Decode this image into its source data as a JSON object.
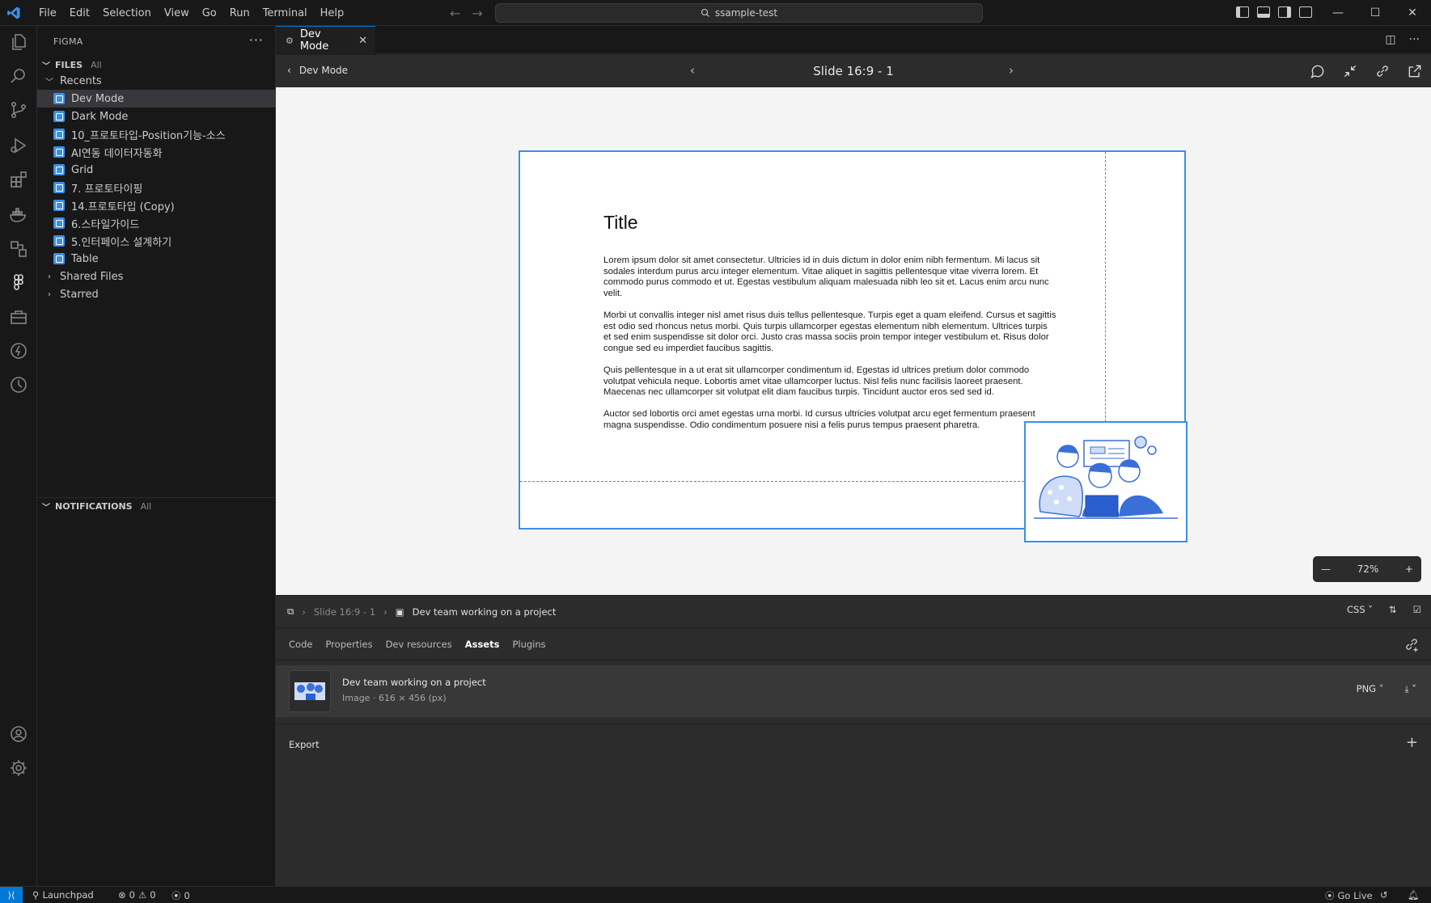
{
  "window": {
    "menu": [
      "File",
      "Edit",
      "Selection",
      "View",
      "Go",
      "Run",
      "Terminal",
      "Help"
    ],
    "search": "ssample-test"
  },
  "sidebar": {
    "title": "FIGMA",
    "files_section": {
      "label": "FILES",
      "filter": "All"
    },
    "recents_label": "Recents",
    "recents": [
      "Dev Mode",
      "Dark Mode",
      "10_프로토타입-Position기능-소스",
      "AI연동 데이터자동화",
      "Grid",
      "7. 프로토타이핑",
      "14.프로토타입 (Copy)",
      "6.스타일가이드",
      "5.인터페이스 설계하기",
      "Table"
    ],
    "shared_label": "Shared Files",
    "starred_label": "Starred",
    "notifications_section": {
      "label": "NOTIFICATIONS",
      "filter": "All"
    }
  },
  "editor": {
    "tab_label": "Dev Mode",
    "devbar": {
      "back_label": "Dev Mode",
      "slide_title": "Slide 16:9 - 1",
      "zoom": "72%"
    },
    "slide": {
      "title": "Title",
      "paragraphs": [
        "Lorem ipsum dolor sit amet consectetur. Ultricies id in duis dictum in dolor enim nibh fermentum. Mi lacus sit sodales interdum purus arcu integer elementum. Vitae aliquet in sagittis pellentesque vitae viverra lorem. Et commodo purus commodo et ut. Egestas vestibulum aliquam malesuada nibh leo sit et. Lacus enim arcu nunc velit.",
        "Morbi ut convallis integer nisl amet risus duis tellus pellentesque. Turpis eget a quam eleifend. Cursus et sagittis est odio sed rhoncus netus morbi. Quis turpis ullamcorper egestas elementum nibh elementum. Ultrices turpis et sed enim suspendisse sit dolor orci. Justo cras massa sociis proin tempor integer vestibulum et. Risus dolor congue sed eu imperdiet faucibus sagittis.",
        "Quis pellentesque in a ut erat sit ullamcorper condimentum id. Egestas id ultrices pretium dolor commodo volutpat vehicula neque. Lobortis amet vitae ullamcorper luctus. Nisl felis nunc facilisis laoreet praesent. Maecenas nec ullamcorper sit volutpat elit diam faucibus turpis. Tincidunt auctor eros sed sed id.",
        "Auctor sed lobortis orci amet egestas urna morbi. Id cursus ultricies volutpat arcu eget fermentum praesent magna suspendisse. Odio condimentum posuere nisi a felis purus tempus praesent pharetra."
      ]
    },
    "inspect": {
      "crumb_parent": "Slide 16:9 - 1",
      "crumb_current": "Dev team working on a project",
      "lang": "CSS",
      "tabs": [
        "Code",
        "Properties",
        "Dev resources",
        "Assets",
        "Plugins"
      ],
      "active_tab": "Assets",
      "asset": {
        "name": "Dev team working on a project",
        "meta": "Image · 616 × 456 (px)",
        "format": "PNG"
      },
      "export_label": "Export"
    }
  },
  "statusbar": {
    "launchpad": "Launchpad",
    "errors": "0",
    "warnings": "0",
    "ports": "0",
    "go_live": "Go Live"
  },
  "colors": {
    "accent": "#0078d4",
    "selection": "#3b8eea"
  }
}
